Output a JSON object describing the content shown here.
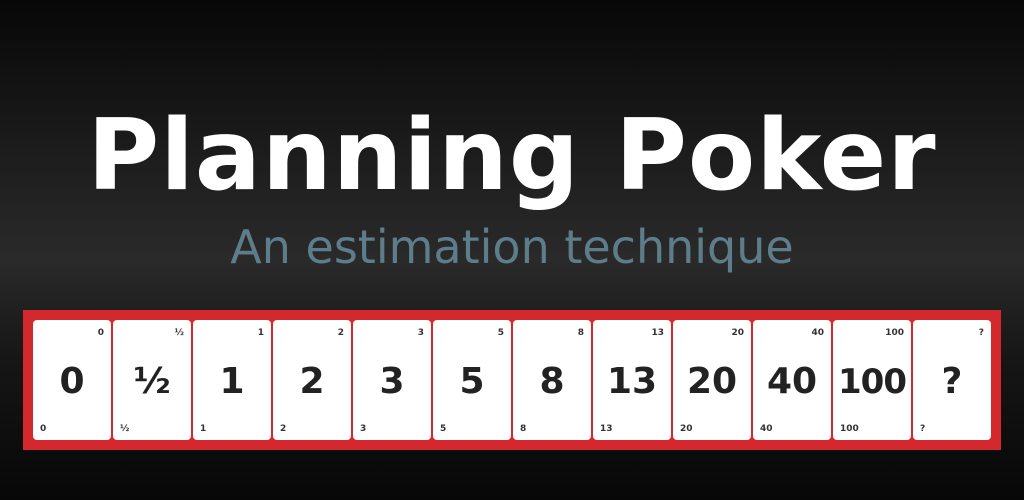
{
  "title": "Planning Poker",
  "subtitle": "An estimation technique",
  "colors": {
    "title": "#ffffff",
    "subtitle": "#5e7d8a",
    "deck_border": "#d3282d",
    "card": "#ffffff",
    "card_text": "#222222"
  },
  "cards": [
    {
      "label": "0"
    },
    {
      "label": "½"
    },
    {
      "label": "1"
    },
    {
      "label": "2"
    },
    {
      "label": "3"
    },
    {
      "label": "5"
    },
    {
      "label": "8"
    },
    {
      "label": "13"
    },
    {
      "label": "20"
    },
    {
      "label": "40"
    },
    {
      "label": "100"
    },
    {
      "label": "?"
    }
  ]
}
